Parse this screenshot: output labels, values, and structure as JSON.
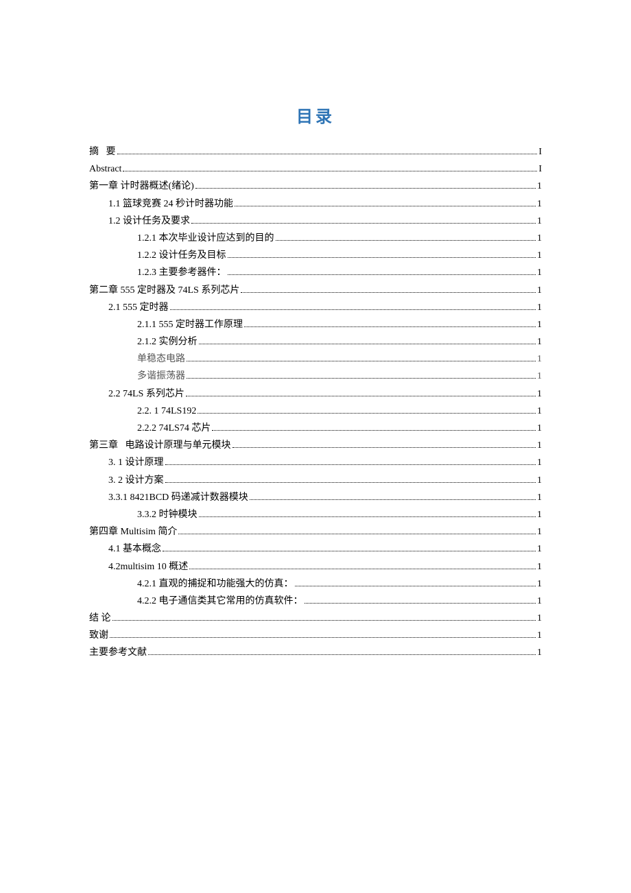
{
  "title": "目录",
  "toc": [
    {
      "label": "摘   要",
      "page": "I",
      "indent": "indent-0"
    },
    {
      "label": "Abstract",
      "page": "I",
      "indent": "indent-0"
    },
    {
      "label": "第一章 计时器概述(绪论)",
      "page": "1",
      "indent": "indent-0"
    },
    {
      "label": "1.1 篮球竞赛 24 秒计时器功能",
      "page": "1",
      "indent": "indent-1"
    },
    {
      "label": "1.2 设计任务及要求",
      "page": "1",
      "indent": "indent-1"
    },
    {
      "label": "1.2.1 本次毕业设计应达到的目的",
      "page": "1",
      "indent": "indent-2"
    },
    {
      "label": "1.2.2 设计任务及目标",
      "page": "1",
      "indent": "indent-2"
    },
    {
      "label": "1.2.3 主要参考器件：",
      "page": "1",
      "indent": "indent-2"
    },
    {
      "label": "第二章 555 定时器及 74LS 系列芯片",
      "page": "1",
      "indent": "indent-0"
    },
    {
      "label": "2.1 555 定时器",
      "page": "1",
      "indent": "indent-1"
    },
    {
      "label": "2.1.1 555 定时器工作原理",
      "page": "1",
      "indent": "indent-2"
    },
    {
      "label": "2.1.2 实例分析",
      "page": "1",
      "indent": "indent-2"
    },
    {
      "label": "单稳态电路",
      "page": "1",
      "indent": "indent-2b"
    },
    {
      "label": "多谐振荡器",
      "page": "1",
      "indent": "indent-2b"
    },
    {
      "label": "2.2 74LS 系列芯片",
      "page": "1",
      "indent": "indent-1"
    },
    {
      "label": "2.2. 1 74LS192",
      "page": "1",
      "indent": "indent-2"
    },
    {
      "label": "2.2.2 74LS74 芯片",
      "page": "1",
      "indent": "indent-2"
    },
    {
      "label": "第三章   电路设计原理与单元模块",
      "page": "1",
      "indent": "indent-0"
    },
    {
      "label": "3. 1 设计原理",
      "page": "1",
      "indent": "indent-1"
    },
    {
      "label": "3. 2 设计方案",
      "page": "1",
      "indent": "indent-1"
    },
    {
      "label": "3.3.1 8421BCD 码递减计数器模块",
      "page": "1",
      "indent": "indent-1"
    },
    {
      "label": "3.3.2 时钟模块",
      "page": "1",
      "indent": "indent-2"
    },
    {
      "label": "第四章 Multisim 简介",
      "page": "1",
      "indent": "indent-0"
    },
    {
      "label": "4.1 基本概念",
      "page": "1",
      "indent": "indent-1"
    },
    {
      "label": "4.2multisim 10 概述",
      "page": "1",
      "indent": "indent-1"
    },
    {
      "label": "4.2.1 直观的捕捉和功能强大的仿真：",
      "page": "1",
      "indent": "indent-2"
    },
    {
      "label": "4.2.2 电子通信类其它常用的仿真软件：",
      "page": "1",
      "indent": "indent-2"
    },
    {
      "label": "结 论",
      "page": "1",
      "indent": "indent-0"
    },
    {
      "label": "致谢",
      "page": "1",
      "indent": "indent-0"
    },
    {
      "label": "主要参考文献",
      "page": "1",
      "indent": "indent-0"
    }
  ]
}
